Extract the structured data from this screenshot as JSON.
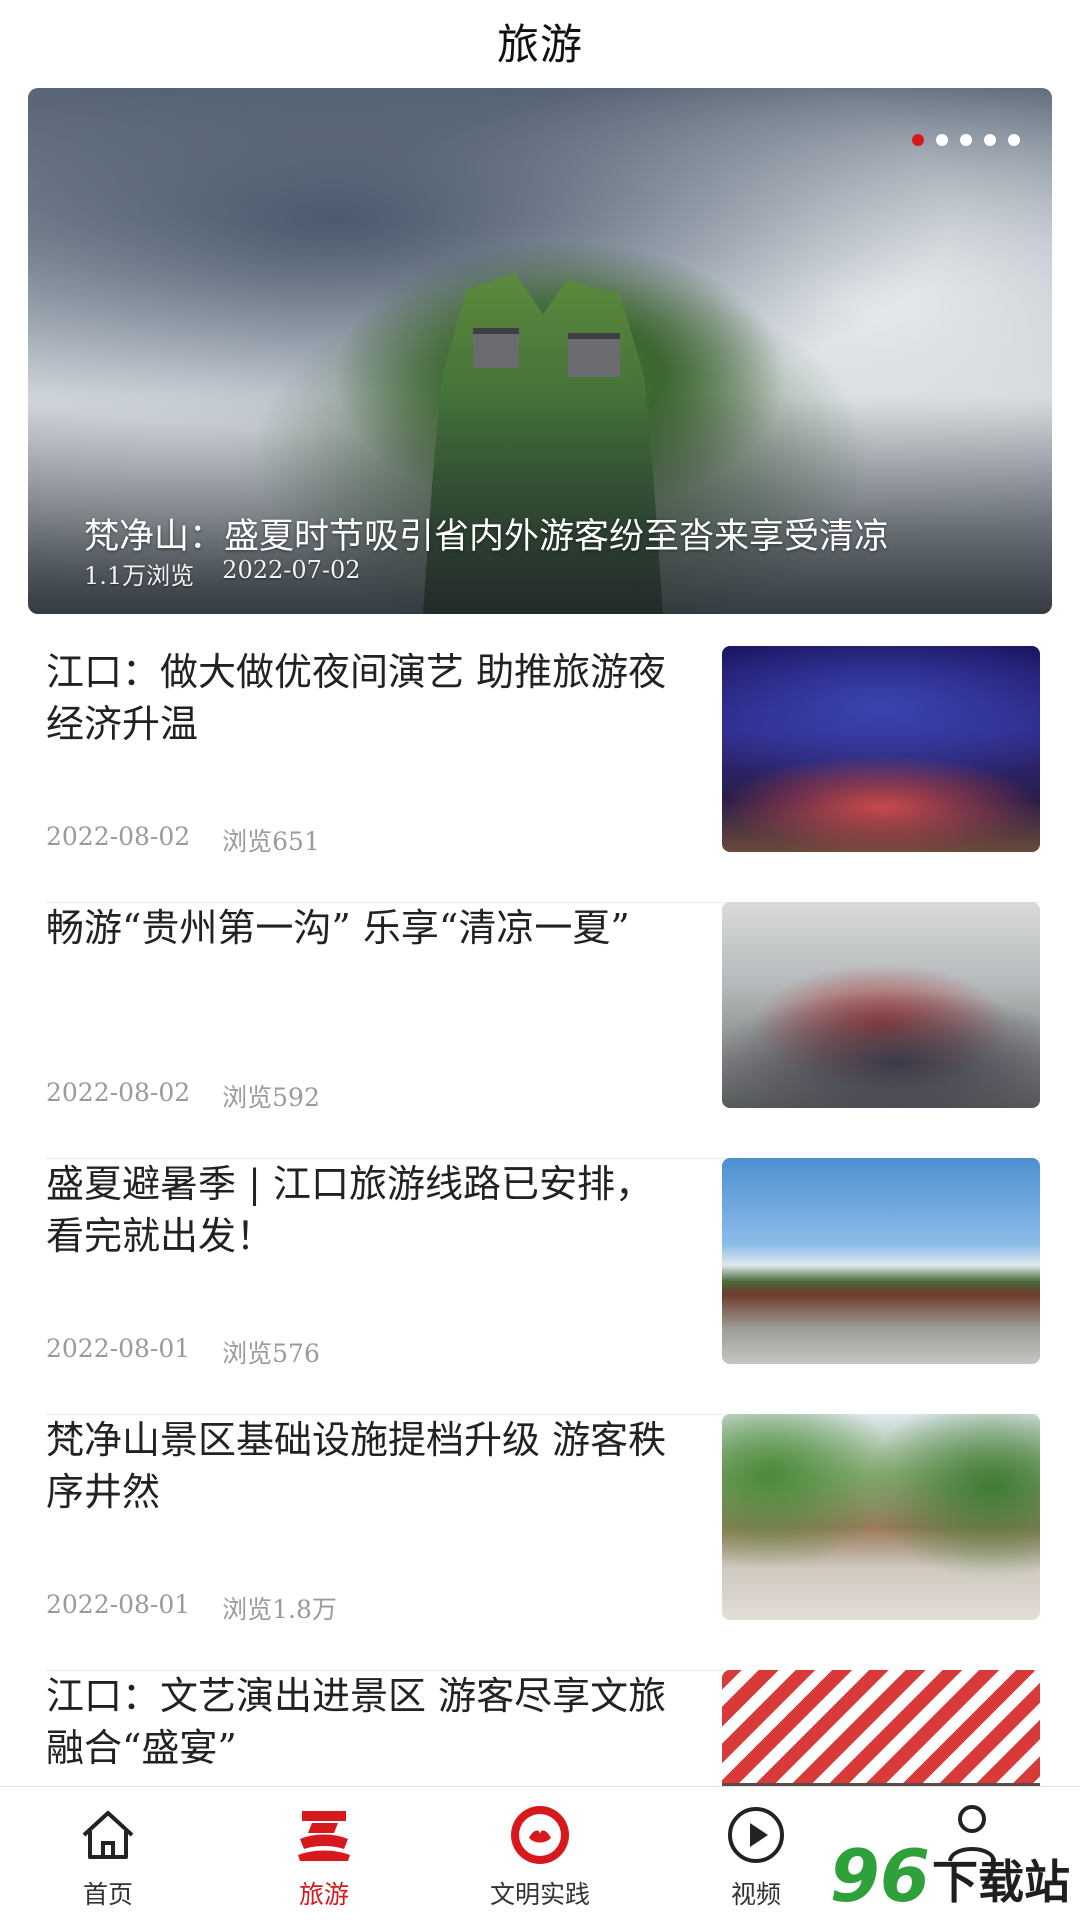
{
  "header": {
    "title": "旅游"
  },
  "banner": {
    "title": "梵净山：盛夏时节吸引省内外游客纷至沓来享受清凉",
    "views": "1.1万浏览",
    "date": "2022-07-02",
    "dots_total": 5,
    "active_dot": 1
  },
  "articles": [
    {
      "title": "江口：做大做优夜间演艺 助推旅游夜经济升温",
      "date": "2022-08-02",
      "views": "浏览651"
    },
    {
      "title": "畅游“贵州第一沟” 乐享“清凉一夏”",
      "date": "2022-08-02",
      "views": "浏览592"
    },
    {
      "title": "盛夏避暑季 | 江口旅游线路已安排，看完就出发！",
      "date": "2022-08-01",
      "views": "浏览576"
    },
    {
      "title": "梵净山景区基础设施提档升级 游客秩序井然",
      "date": "2022-08-01",
      "views": "浏览1.8万"
    },
    {
      "title": "江口：文艺演出进景区 游客尽享文旅融合“盛宴”",
      "date": "",
      "views": ""
    }
  ],
  "tabbar": {
    "items": [
      {
        "label": "首页",
        "icon": "home-icon",
        "active": false
      },
      {
        "label": "旅游",
        "icon": "travel-icon",
        "active": true
      },
      {
        "label": "文明实践",
        "icon": "civilization-badge-icon",
        "active": false
      },
      {
        "label": "视频",
        "icon": "play-icon",
        "active": false
      },
      {
        "label": "",
        "icon": "user-icon",
        "active": false
      }
    ]
  },
  "watermark": {
    "number": "96",
    "text": "下载站"
  },
  "colors": {
    "accent": "#d7191d",
    "meta_text": "#9a9a9a"
  }
}
